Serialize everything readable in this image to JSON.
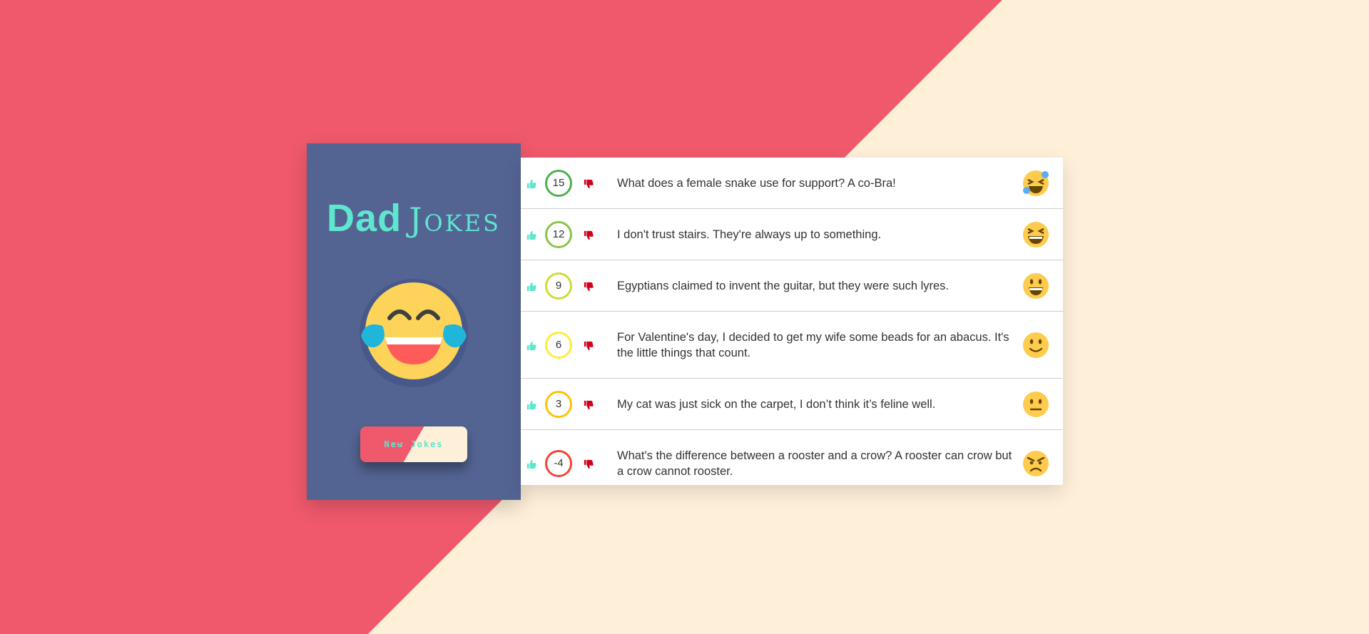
{
  "app": {
    "title_bold": "Dad",
    "title_light": "Jokes",
    "new_jokes_label": "New Jokes"
  },
  "colors": {
    "accent": "#5fe6cf",
    "coral": "#f0596c",
    "cream": "#fdefd8",
    "sidebar": "#536493",
    "upvote": "#5fe6cf",
    "downvote": "#d0021b"
  },
  "jokes": [
    {
      "score": "15",
      "text": "What does a female snake use for support? A co-Bra!",
      "emoji": "rofl-icon",
      "ring": "#4caf50"
    },
    {
      "score": "12",
      "text": "I don't trust stairs. They're always up to something.",
      "emoji": "laughing-icon",
      "ring": "#8bc34a"
    },
    {
      "score": "9",
      "text": "Egyptians claimed to invent the guitar, but they were such lyres.",
      "emoji": "smiley-icon",
      "ring": "#cddc39"
    },
    {
      "score": "6",
      "text": "For Valentine's day, I decided to get my wife some beads for an abacus. It's the little things that count.",
      "emoji": "slight-smile-icon",
      "ring": "#ffeb3b"
    },
    {
      "score": "3",
      "text": "My cat was just sick on the carpet, I don’t think it’s feline well.",
      "emoji": "neutral-face-icon",
      "ring": "#ffc107"
    },
    {
      "score": "-4",
      "text": "What's the difference between a rooster and a crow? A rooster can crow but a crow cannot rooster.",
      "emoji": "angry-face-icon",
      "ring": "#f44336"
    }
  ]
}
